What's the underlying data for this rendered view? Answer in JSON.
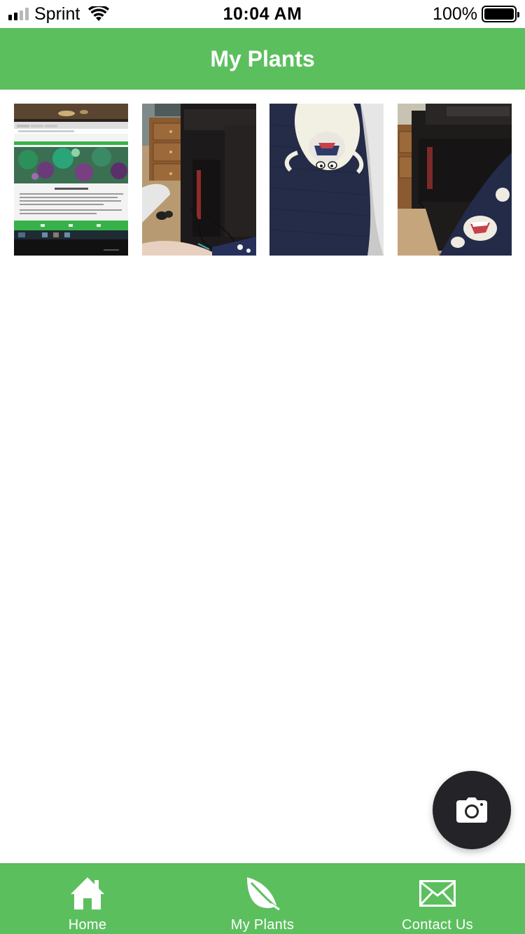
{
  "status_bar": {
    "carrier": "Sprint",
    "time": "10:04 AM",
    "battery_percent": "100%",
    "signal_bars": 2,
    "signal_bars_total": 4,
    "battery_level": 1.0
  },
  "header": {
    "title": "My Plants"
  },
  "photos": [
    {
      "icon": "photo-monitor-website"
    },
    {
      "icon": "photo-desk-computer"
    },
    {
      "icon": "photo-yeti-sock"
    },
    {
      "icon": "photo-desk-sock"
    }
  ],
  "fab": {
    "icon": "camera-icon"
  },
  "tab_bar": {
    "items": [
      {
        "label": "Home",
        "icon": "home-icon"
      },
      {
        "label": "My Plants",
        "icon": "leaf-icon"
      },
      {
        "label": "Contact Us",
        "icon": "mail-icon"
      }
    ]
  },
  "colors": {
    "accent": "#5cbf5e",
    "fab": "#242428",
    "white": "#ffffff"
  }
}
